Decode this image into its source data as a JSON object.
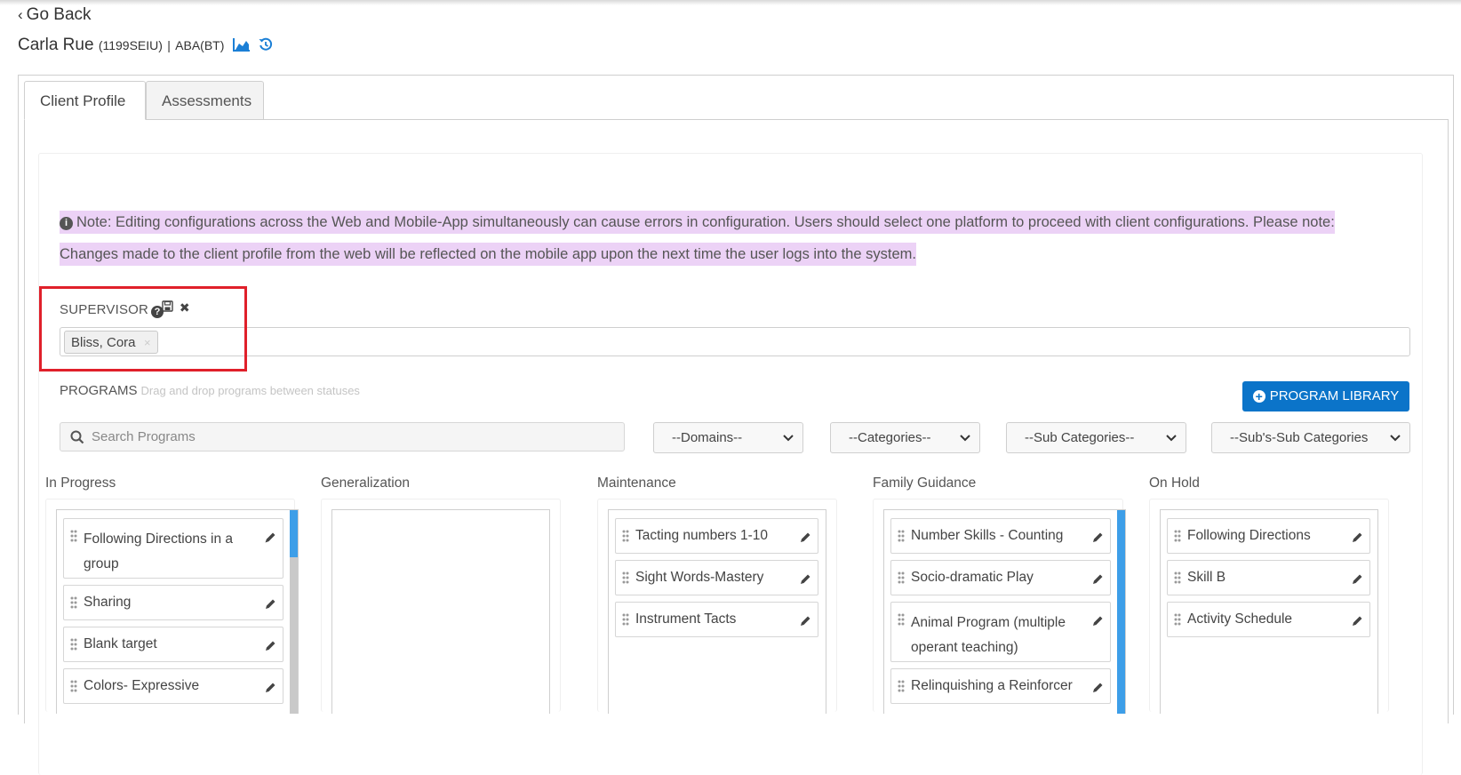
{
  "nav": {
    "go_back": "Go Back"
  },
  "client": {
    "name": "Carla Rue",
    "code": "(1199SEIU)",
    "separator": "|",
    "service": "ABA(BT)"
  },
  "tabs": {
    "client_profile": "Client Profile",
    "assessments": "Assessments"
  },
  "note": {
    "line1": "Note: Editing configurations across the Web and Mobile-App simultaneously can cause errors in configuration. Users should select one platform to proceed with client configurations. Please note:",
    "line2": "Changes made to the client profile from the web will be reflected on the mobile app upon the next time the user logs into the system."
  },
  "supervisor": {
    "label": "SUPERVISOR",
    "selected": "Bliss, Cora",
    "remove_char": "×"
  },
  "programs": {
    "label": "PROGRAMS",
    "hint": "Drag and drop programs between statuses",
    "library_button": "PROGRAM LIBRARY",
    "search_placeholder": "Search Programs",
    "filters": {
      "domains": "--Domains--",
      "categories": "--Categories--",
      "sub_categories": "--Sub Categories--",
      "subs_sub_categories": "--Sub's-Sub Categories"
    }
  },
  "columns": {
    "in_progress": {
      "title": "In Progress",
      "items": [
        "Following Directions in a",
        "group",
        "Sharing",
        "Blank target",
        "Colors- Expressive"
      ]
    },
    "generalization": {
      "title": "Generalization"
    },
    "maintenance": {
      "title": "Maintenance",
      "items": [
        "Tacting numbers 1-10",
        "Sight Words-Mastery",
        "Instrument Tacts"
      ]
    },
    "family_guidance": {
      "title": "Family Guidance",
      "items": [
        "Number Skills - Counting",
        "Socio-dramatic Play",
        "Animal Program (multiple",
        "operant teaching)",
        "Relinquishing a Reinforcer"
      ]
    },
    "on_hold": {
      "title": "On Hold",
      "items": [
        "Following Directions",
        "Skill B",
        "Activity Schedule"
      ]
    }
  },
  "colors": {
    "primary": "#0b74c9",
    "highlight": "#ecd2f6",
    "scroll_accent": "#3d9ee8",
    "annotation": "#e0202a"
  }
}
